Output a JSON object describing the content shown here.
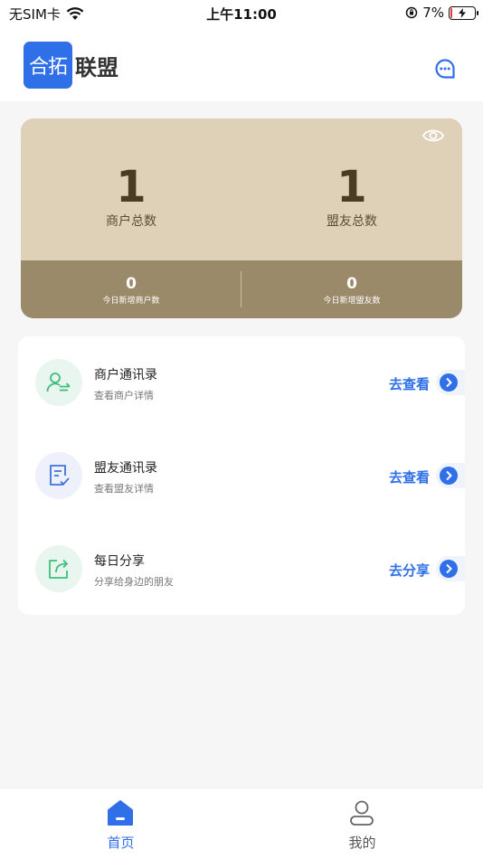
{
  "status_bar": {
    "carrier": "无SIM卡",
    "time": "上午11:00",
    "battery": "7%",
    "battery_level": 0.07
  },
  "header": {
    "logo_box_text": "合拓",
    "logo_text": "联盟",
    "chat_icon": "chat-bubble-icon"
  },
  "stats": {
    "merchant_total_value": "1",
    "merchant_total_label": "商户总数",
    "ally_total_value": "1",
    "ally_total_label": "盟友总数",
    "today_merchant_value": "0",
    "today_merchant_label": "今日新增商户数",
    "today_ally_value": "0",
    "today_ally_label": "今日新增盟友数"
  },
  "list": [
    {
      "title": "商户通讯录",
      "subtitle": "查看商户详情",
      "action": "去查看",
      "icon": "user-transfer-icon"
    },
    {
      "title": "盟友通讯录",
      "subtitle": "查看盟友详情",
      "action": "去查看",
      "icon": "document-check-icon"
    },
    {
      "title": "每日分享",
      "subtitle": "分享给身边的朋友",
      "action": "去分享",
      "icon": "share-icon"
    }
  ],
  "tabs": [
    {
      "label": "首页",
      "active": true
    },
    {
      "label": "我的",
      "active": false
    }
  ],
  "colors": {
    "accent": "#2f6fe8",
    "card_top": "#dfd1b8",
    "card_bottom": "#9b8a69"
  }
}
